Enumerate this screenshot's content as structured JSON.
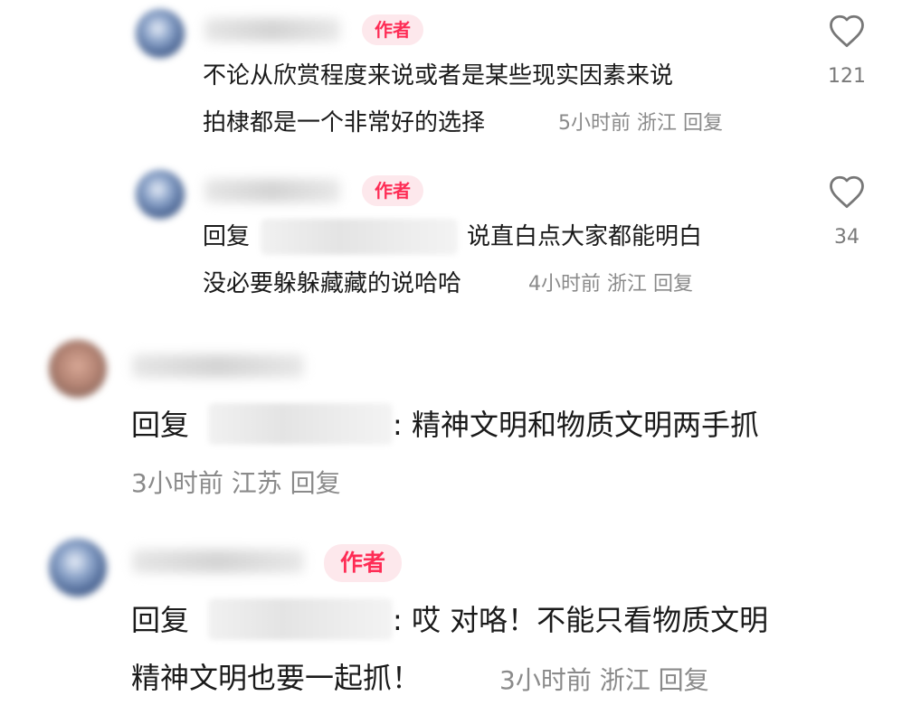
{
  "comments": [
    {
      "badge": "作者",
      "line1": "不论从欣赏程度来说或者是某些现实因素来说",
      "line2": "拍棣都是一个非常好的选择",
      "meta": "5小时前 浙江 回复",
      "likes": "121"
    },
    {
      "badge": "作者",
      "reply_prefix": "回复",
      "line1_rest": "说直白点大家都能明白",
      "line2": "没必要躲躲藏藏的说哈哈",
      "meta": "4小时前 浙江 回复",
      "likes": "34"
    },
    {
      "reply_prefix": "回复",
      "line1_rest": ": 精神文明和物质文明两手抓",
      "meta": "3小时前 江苏 回复"
    },
    {
      "badge": "作者",
      "reply_prefix": "回复",
      "line1_rest": ": 哎 对咯！不能只看物质文明",
      "line2": "精神文明也要一起抓！",
      "meta": "3小时前 浙江 回复"
    }
  ],
  "icons": {
    "like": "heart-outline-icon"
  },
  "colors": {
    "author_badge_text": "#fe2c55",
    "author_badge_bg": "#fde8ec",
    "meta_text": "#8a8a8a"
  }
}
